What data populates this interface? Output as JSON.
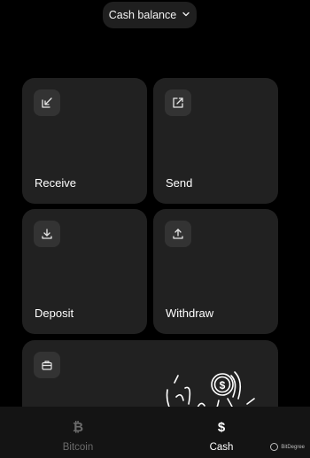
{
  "header": {
    "balance_selector": "Cash balance",
    "chevron_icon": "chevron-down-icon"
  },
  "tiles": [
    {
      "label": "Receive",
      "icon": "arrow-down-left-icon"
    },
    {
      "label": "Send",
      "icon": "arrow-up-right-icon"
    },
    {
      "label": "Deposit",
      "icon": "download-icon"
    },
    {
      "label": "Withdraw",
      "icon": "upload-icon"
    },
    {
      "label": "",
      "icon": "briefcase-icon"
    }
  ],
  "bottom_nav": {
    "items": [
      {
        "label": "Bitcoin",
        "glyph": "₿",
        "active": false
      },
      {
        "label": "Cash",
        "glyph": "$",
        "active": true
      }
    ]
  },
  "watermark": {
    "text": "BitDegree"
  },
  "colors": {
    "background": "#000000",
    "tile": "#212121",
    "icon_box": "#333333",
    "inactive_nav": "#6b6b6b",
    "active_nav": "#ffffff"
  }
}
